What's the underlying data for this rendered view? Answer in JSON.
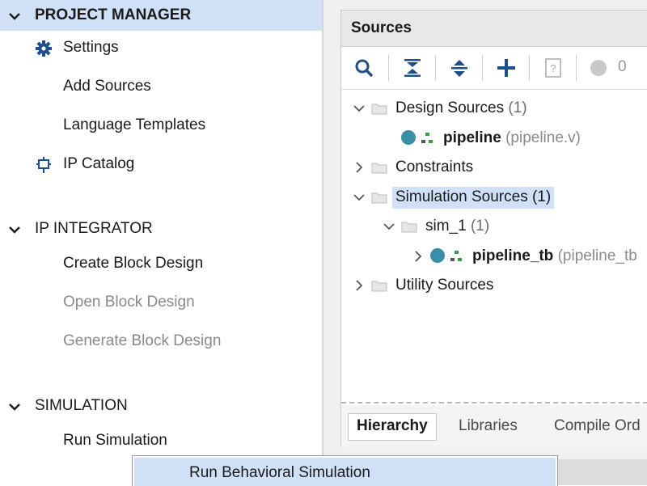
{
  "nav": {
    "project_manager": {
      "title": "PROJECT MANAGER",
      "items": [
        {
          "label": "Settings",
          "icon": "gear-icon"
        },
        {
          "label": "Add Sources"
        },
        {
          "label": "Language Templates"
        },
        {
          "label": "IP Catalog",
          "icon": "ip-plug-icon"
        }
      ]
    },
    "ip_integrator": {
      "title": "IP INTEGRATOR",
      "items": [
        {
          "label": "Create Block Design",
          "enabled": true
        },
        {
          "label": "Open Block Design",
          "enabled": false
        },
        {
          "label": "Generate Block Design",
          "enabled": false
        }
      ]
    },
    "simulation": {
      "title": "SIMULATION",
      "items": [
        {
          "label": "Run Simulation"
        }
      ]
    }
  },
  "sources": {
    "title": "Sources",
    "toolbar": {
      "icons": [
        "search-icon",
        "collapse-all-icon",
        "expand-all-icon",
        "add-icon",
        "help-icon",
        "status-circle-icon"
      ],
      "issue_count": "0"
    },
    "tree": {
      "design_sources": {
        "label": "Design Sources",
        "count": "(1)"
      },
      "pipeline": {
        "name": "pipeline",
        "file": "(pipeline.v)"
      },
      "constraints": {
        "label": "Constraints"
      },
      "simulation_sources": {
        "label": "Simulation Sources (1)"
      },
      "sim_1": {
        "label": "sim_1",
        "count": "(1)"
      },
      "pipeline_tb": {
        "name": "pipeline_tb",
        "file": "(pipeline_tb"
      },
      "utility_sources": {
        "label": "Utility Sources"
      }
    },
    "tabs": [
      "Hierarchy",
      "Libraries",
      "Compile Ord"
    ]
  },
  "context_menu": {
    "item": "Run Behavioral Simulation"
  },
  "colors": {
    "selection": "#cfe0f7",
    "source_dot": "#3a8fa8",
    "hierarchy_icon": "#3d9a4a",
    "toolbar_icon": "#1f4e8c"
  }
}
